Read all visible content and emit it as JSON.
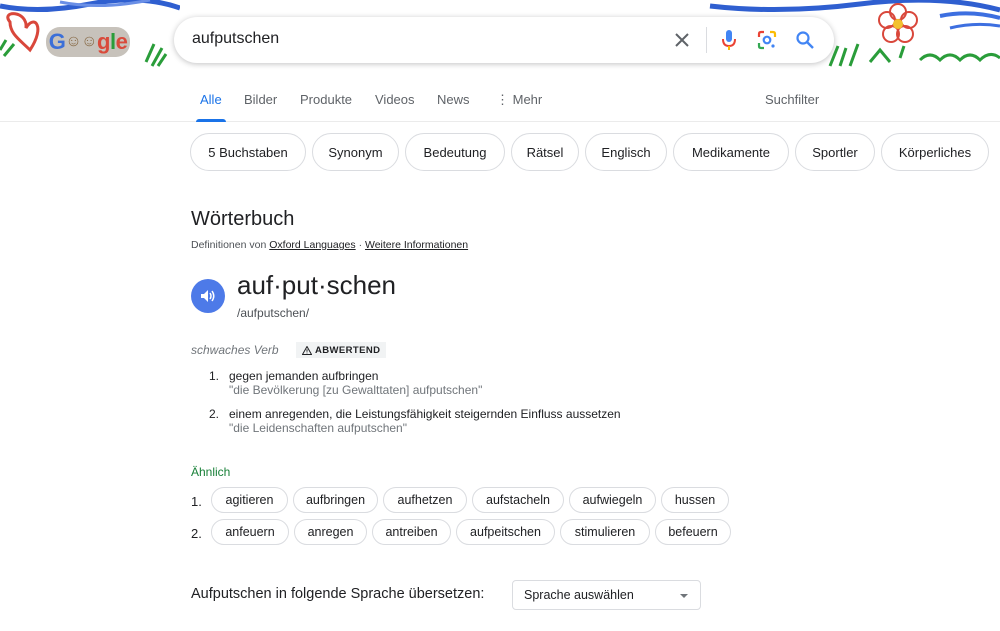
{
  "header": {
    "logo_text": "Google",
    "search_value": "aufputschen",
    "icons": [
      "clear-icon",
      "mic-icon",
      "lens-icon",
      "search-icon"
    ]
  },
  "tabs": [
    {
      "label": "Alle",
      "active": true
    },
    {
      "label": "Bilder"
    },
    {
      "label": "Produkte"
    },
    {
      "label": "Videos"
    },
    {
      "label": "News"
    },
    {
      "label": "Mehr"
    }
  ],
  "tools_label": "Suchfilter",
  "chips": [
    "5 Buchstaben",
    "Synonym",
    "Bedeutung",
    "Rätsel",
    "Englisch",
    "Medikamente",
    "Sportler",
    "Körperliches"
  ],
  "dictionary": {
    "heading": "Wörterbuch",
    "source_prefix": "Definitionen von",
    "source_link": "Oxford Languages",
    "separator": "·",
    "more_link": "Weitere Informationen",
    "headword": "auf·put·schen",
    "pronunciation": "/aufputschen/",
    "part_of_speech": "schwaches Verb",
    "usage_tag": "ABWERTEND",
    "senses": [
      {
        "num": "1.",
        "definition": "gegen jemanden aufbringen",
        "example": "\"die Bevölkerung [zu Gewalttaten] aufputschen\""
      },
      {
        "num": "2.",
        "definition": "einem anregenden, die Leistungsfähigkeit steigernden Einfluss aussetzen",
        "example": "\"die Leidenschaften aufputschen\""
      }
    ],
    "similar_label": "Ähnlich",
    "synonym_groups": [
      {
        "num": "1.",
        "words": [
          "agitieren",
          "aufbringen",
          "aufhetzen",
          "aufstacheln",
          "aufwiegeln",
          "hussen"
        ]
      },
      {
        "num": "2.",
        "words": [
          "anfeuern",
          "anregen",
          "antreiben",
          "aufpeitschen",
          "stimulieren",
          "befeuern"
        ]
      }
    ],
    "translate_label": "Aufputschen in folgende Sprache übersetzen:",
    "language_select": "Sprache auswählen"
  },
  "colors": {
    "accent": "#1a73e8",
    "speaker": "#4d7ae8",
    "similar": "#188038"
  }
}
